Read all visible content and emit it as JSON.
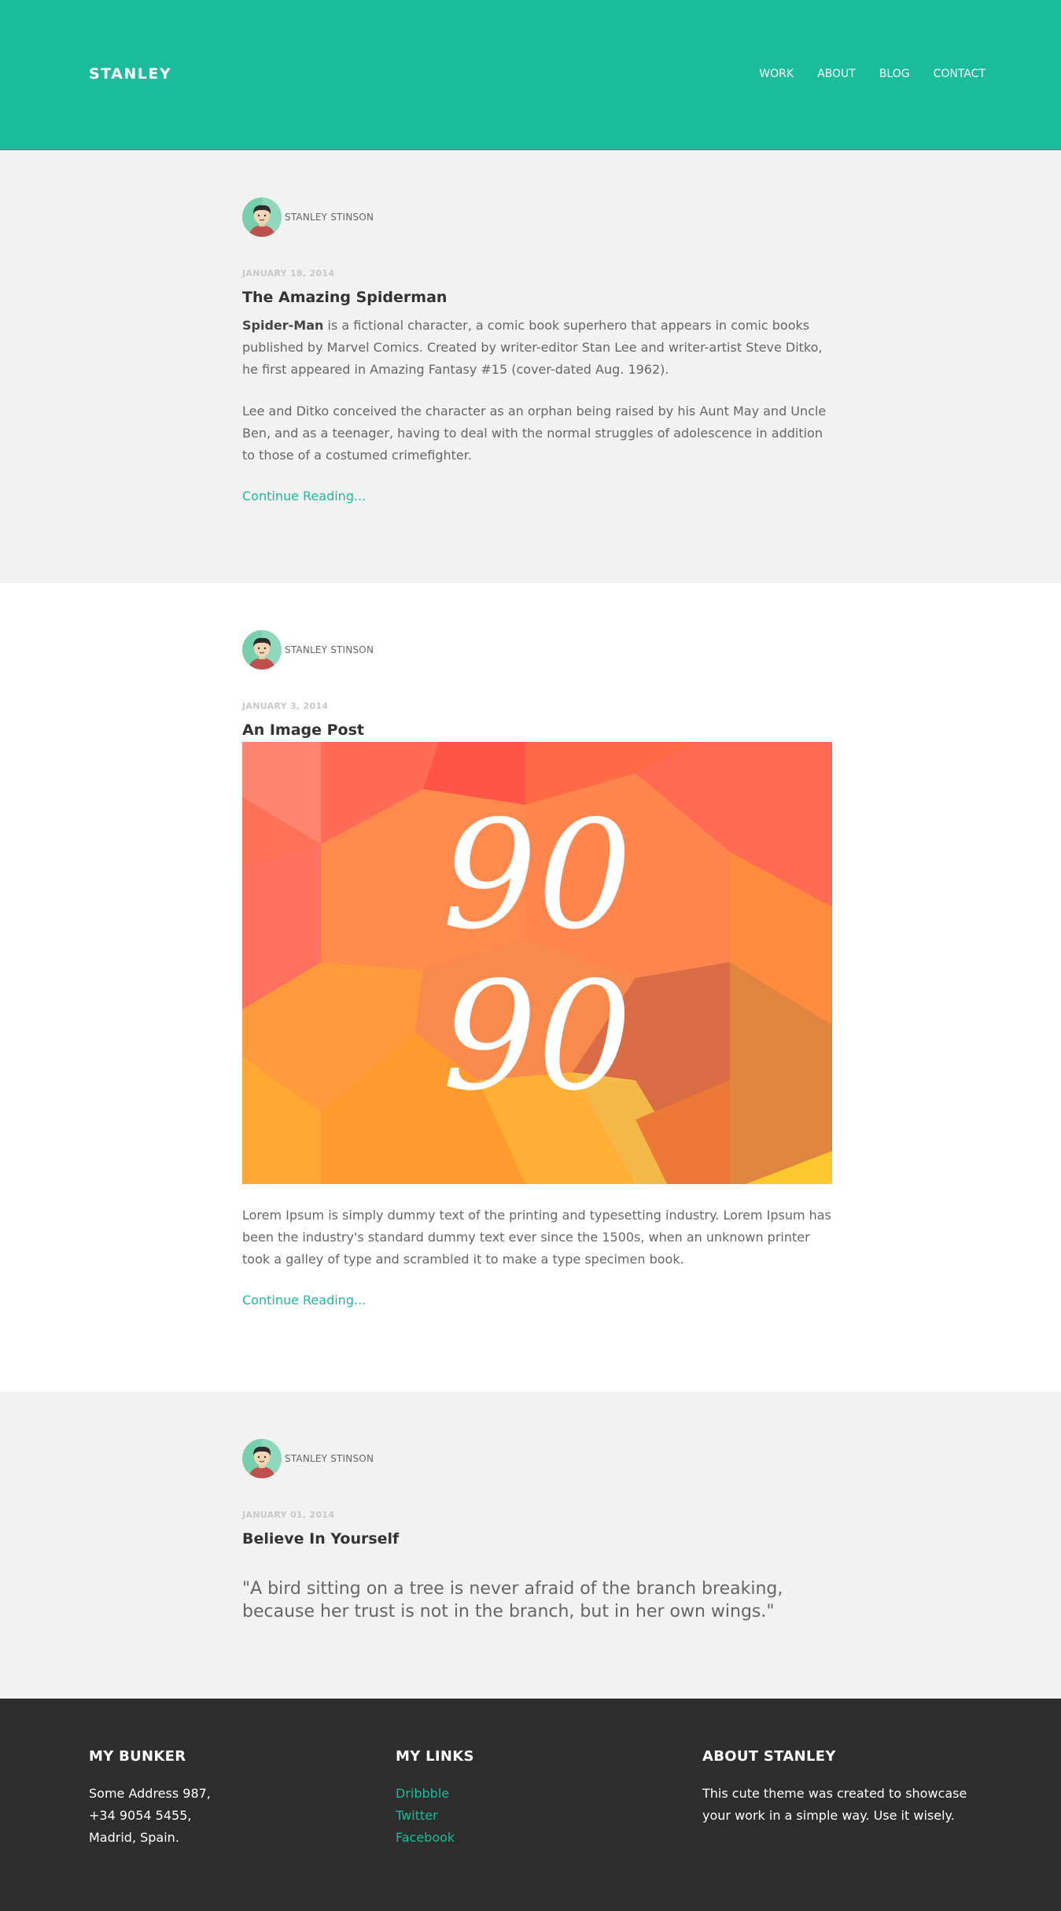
{
  "header": {
    "brand": "STANLEY",
    "nav": [
      "WORK",
      "ABOUT",
      "BLOG",
      "CONTACT"
    ],
    "color": "#1abc9c"
  },
  "posts": [
    {
      "author": "STANLEY STINSON",
      "date": "JANUARY 18, 2014",
      "title": "The Amazing Spiderman",
      "lead_bold": "Spider-Man",
      "para1_rest": " is a fictional character, a comic book superhero that appears in comic books published by Marvel Comics. Created by writer-editor Stan Lee and writer-artist Steve Ditko, he first appeared in Amazing Fantasy #15 (cover-dated Aug. 1962).",
      "para2": "Lee and Ditko conceived the character as an orphan being raised by his Aunt May and Uncle Ben, and as a teenager, having to deal with the normal struggles of adolescence in addition to those of a costumed crimefighter.",
      "link": "Continue Reading..."
    },
    {
      "author": "STANLEY STINSON",
      "date": "JANUARY 3, 2014",
      "title": "An Image Post",
      "image_text_line1": "90",
      "image_text_line2": "90",
      "para": "Lorem Ipsum is simply dummy text of the printing and typesetting industry. Lorem Ipsum has been the industry's standard dummy text ever since the 1500s, when an unknown printer took a galley of type and scrambled it to make a type specimen book.",
      "link": "Continue Reading..."
    },
    {
      "author": "STANLEY STINSON",
      "date": "JANUARY 01, 2014",
      "title": "Believe In Yourself",
      "quote": "\"A bird sitting on a tree is never afraid of the branch breaking, because her trust is not in the branch, but in her own wings.\""
    }
  ],
  "footer": {
    "col1": {
      "title": "MY BUNKER",
      "lines": [
        "Some Address 987,",
        "+34 9054 5455,",
        "Madrid, Spain."
      ]
    },
    "col2": {
      "title": "MY LINKS",
      "links": [
        "Dribbble",
        "Twitter",
        "Facebook"
      ]
    },
    "col3": {
      "title": "ABOUT STANLEY",
      "text": "This cute theme was created to showcase your work in a simple way. Use it wisely."
    }
  }
}
